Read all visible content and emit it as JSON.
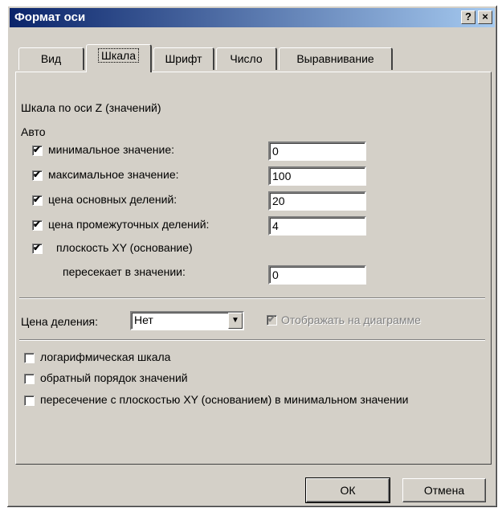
{
  "window": {
    "title": "Формат оси",
    "help_icon": "?",
    "close_icon": "×"
  },
  "tabs": [
    "Вид",
    "Шкала",
    "Шрифт",
    "Число",
    "Выравнивание"
  ],
  "active_tab": "Шкала",
  "section_title": "Шкала по оси Z (значений)",
  "auto_label": "Авто",
  "auto_rows": [
    {
      "label": "минимальное значение:",
      "checked": true,
      "value": "0"
    },
    {
      "label": "максимальное значение:",
      "checked": true,
      "value": "100"
    },
    {
      "label": "цена основных делений:",
      "checked": true,
      "value": "20"
    },
    {
      "label": "цена промежуточных делений:",
      "checked": true,
      "value": "4"
    }
  ],
  "plane": {
    "label": "плоскость XY (основание)",
    "checked": true,
    "cross_label": "пересекает в значении:",
    "cross_value": "0"
  },
  "division": {
    "label": "Цена деления:",
    "value": "Нет",
    "show_label": "Отображать на диаграмме",
    "show_checked": true
  },
  "options": [
    {
      "label": "логарифмическая шкала",
      "checked": false
    },
    {
      "label": "обратный порядок значений",
      "checked": false
    },
    {
      "label": "пересечение с плоскостью XY (основанием) в минимальном значении",
      "checked": false
    }
  ],
  "buttons": {
    "ok": "ОК",
    "cancel": "Отмена"
  }
}
